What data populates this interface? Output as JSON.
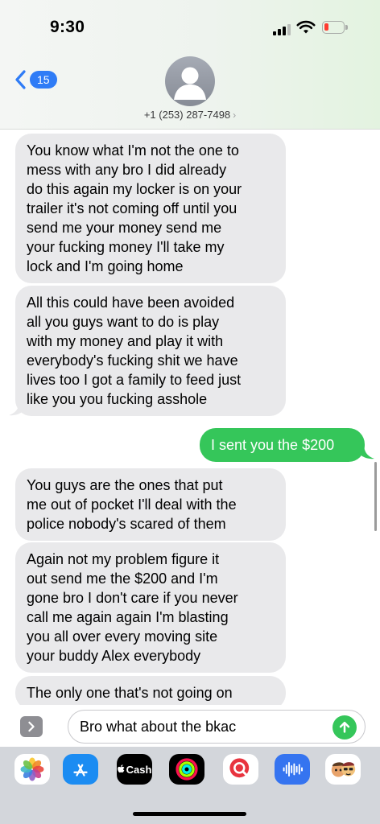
{
  "status_bar": {
    "time": "9:30"
  },
  "header": {
    "back_count": "15",
    "contact_number": "+1 (253) 287-7498",
    "contact_chevron": "›"
  },
  "messages": [
    {
      "direction": "incoming",
      "lines": [
        "You know what I'm not the one to",
        "mess with any bro I did already",
        "do this again my locker is on your",
        "trailer it's not coming off until you",
        "send me your money send me",
        "your fucking money I'll take my",
        "lock and I'm going home"
      ]
    },
    {
      "direction": "incoming",
      "lines": [
        "All this could have been avoided",
        "all you guys want to do is play",
        "with my money and play it with",
        "everybody's fucking shit we have",
        "lives too I got a family to feed just",
        "like you you fucking asshole"
      ]
    },
    {
      "direction": "outgoing",
      "lines": [
        "I sent you the $200"
      ]
    },
    {
      "direction": "incoming",
      "lines": [
        "You guys are the ones that put",
        "me out of pocket I'll deal with the",
        "police nobody's scared of them"
      ]
    },
    {
      "direction": "incoming",
      "lines": [
        "Again not my problem figure it",
        "out send me the $200 and I'm",
        "gone bro I don't care if you never",
        "call me again again I'm blasting",
        "you all over every moving site",
        "your buddy Alex everybody"
      ]
    },
    {
      "direction": "incoming",
      "lines": [
        "The only one that's not going on"
      ]
    }
  ],
  "composer": {
    "input_value": "Bro what about the bkac"
  },
  "app_drawer": {
    "apps": [
      {
        "icon": "photos-icon"
      },
      {
        "icon": "app-store-icon"
      },
      {
        "icon": "apple-cash-icon",
        "label": "Cash"
      },
      {
        "icon": "fitness-icon"
      },
      {
        "icon": "image-search-icon"
      },
      {
        "icon": "audio-message-icon"
      },
      {
        "icon": "memoji-icon"
      }
    ]
  },
  "colors": {
    "incoming_bubble": "#e9e9eb",
    "outgoing_bubble": "#35c65a",
    "back_badge": "#2f7cf6",
    "battery_low": "#ff3b30"
  }
}
